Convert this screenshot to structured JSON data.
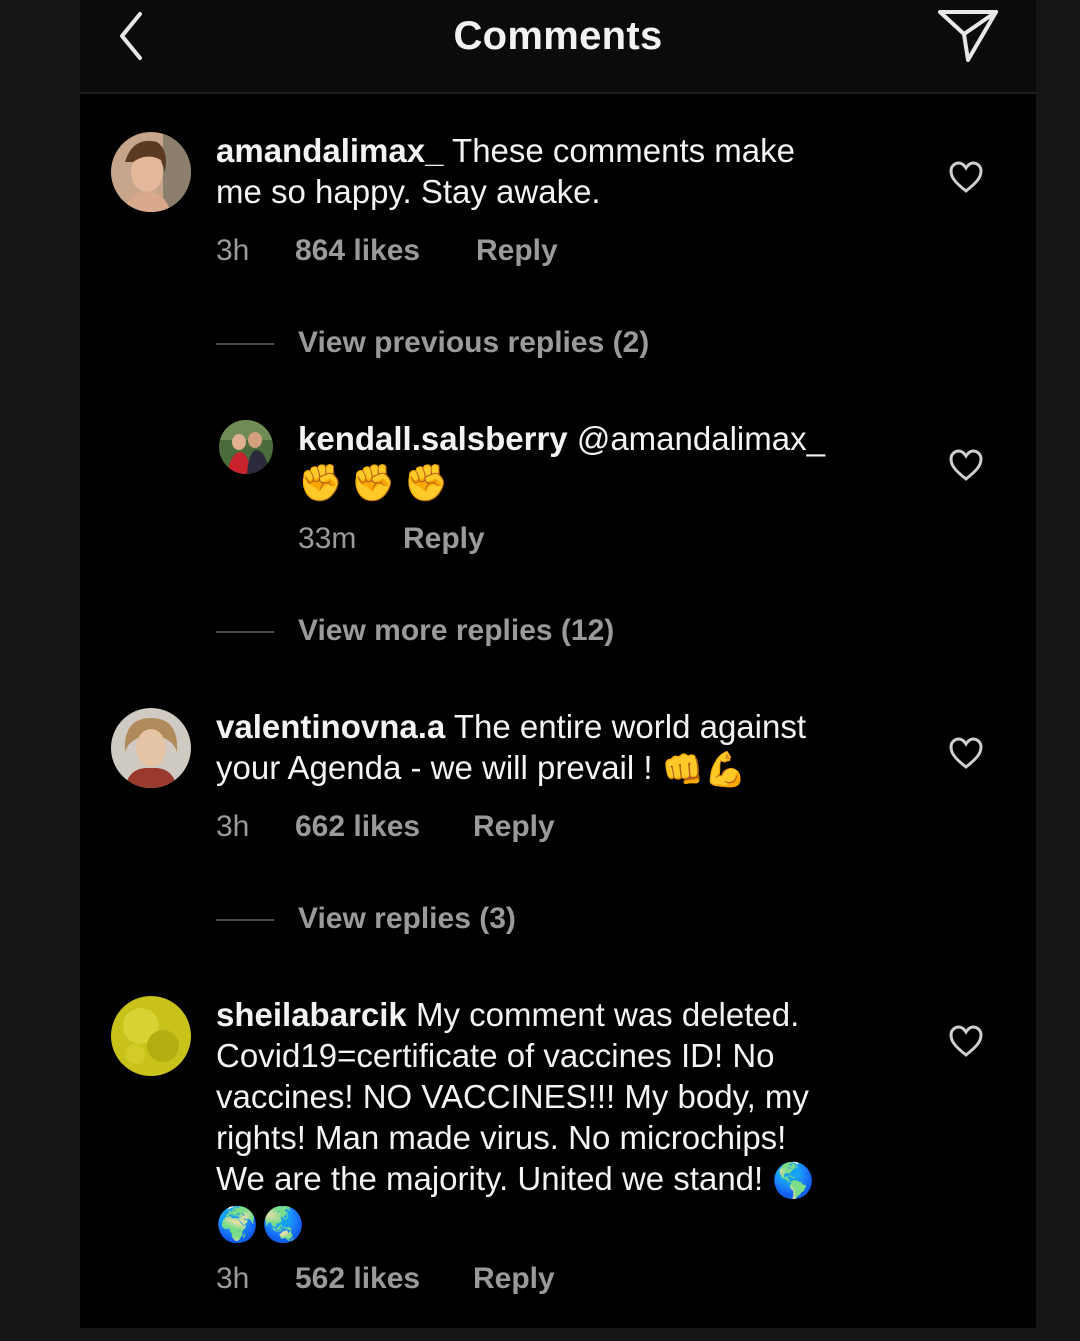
{
  "header": {
    "title": "Comments",
    "back_icon": "chevron-left-icon",
    "send_icon": "paper-plane-icon"
  },
  "comments": [
    {
      "username": "amandalimax_",
      "text_line1": " These comments make",
      "text_line2": "me so happy. Stay awake.",
      "time": "3h",
      "likes": "864 likes",
      "reply": "Reply"
    },
    {
      "username": "kendall.salsberry",
      "text_line1": " @amandalimax_",
      "emoji": "✊✊✊",
      "time": "33m",
      "reply": "Reply"
    },
    {
      "username": "valentinovna.a",
      "text_line1": " The entire world against",
      "text_line2": "your Agenda - we will prevail ! ",
      "emoji": "👊💪",
      "time": "3h",
      "likes": "662 likes",
      "reply": "Reply"
    },
    {
      "username": "sheilabarcik",
      "text_line1": " My comment was deleted.",
      "text_line2": "Covid19=certificate of vaccines ID! No",
      "text_line3": "vaccines! NO VACCINES!!! My body, my",
      "text_line4": "rights! Man made virus. No microchips!",
      "text_line5": "We are the majority. United we stand! ",
      "emoji_inline": "🌎",
      "emoji_line6": "🌍🌏",
      "time": "3h",
      "likes": "562 likes",
      "reply": "Reply"
    }
  ],
  "view_links": {
    "previous": "View previous replies (2)",
    "more": "View more replies (12)",
    "replies": "View replies (3)"
  },
  "colors": {
    "background": "#000000",
    "text": "#f3f3f3",
    "muted": "#9a9a9a",
    "header": "#0b0b0b"
  }
}
